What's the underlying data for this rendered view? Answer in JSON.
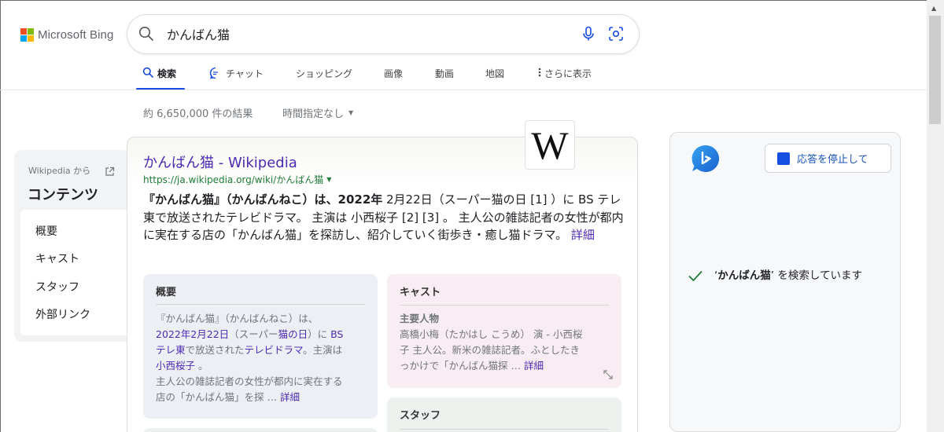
{
  "brand": {
    "logo_text": "Microsoft Bing",
    "logo_colors": [
      "#f25022",
      "#7fba00",
      "#00a4ef",
      "#ffb900"
    ]
  },
  "search": {
    "query": "かんばん猫",
    "icons": [
      "search-icon",
      "microphone-icon",
      "visual-search-icon"
    ]
  },
  "tabs": [
    {
      "label": "検索",
      "icon": "search-icon",
      "active": true
    },
    {
      "label": "チャット",
      "icon": "chat-icon"
    },
    {
      "label": "ショッピング"
    },
    {
      "label": "画像"
    },
    {
      "label": "動画"
    },
    {
      "label": "地図"
    },
    {
      "label": "さらに表示",
      "icon": "more-vertical-icon"
    }
  ],
  "results_meta": {
    "count": "約 6,650,000 件の結果",
    "time_filter": "時間指定なし"
  },
  "contents_panel": {
    "source": "Wikipedia から",
    "title": "コンテンツ",
    "items": [
      "概要",
      "キャスト",
      "スタッフ",
      "外部リンク"
    ]
  },
  "result": {
    "title": "かんばん猫 - Wikipedia",
    "url": "https://ja.wikipedia.org/wiki/かんばん猫",
    "logo_letter": "W",
    "snippet": {
      "bold": "『かんばん猫』（かんばんねこ）は、2022年",
      "text": " 2月22日（スーパー猫の日 [1] ）に BS テレ東で放送されたテレビドラマ。 主演は 小西桜子 [2] [3] 。 主人公の雑誌記者の女性が都内に実在する店の「かんばん猫」を探訪し、紹介していく街歩き・癒し猫ドラマ。 ",
      "more": "詳細"
    }
  },
  "subcards": {
    "overview": {
      "title": "概要",
      "lines": [
        {
          "text": "『かんばん猫』（かんばんねこ）は、"
        },
        {
          "link1": "2022年2月22日",
          "text1": "（スーパー",
          "link2": "猫の日",
          "text2": "）に ",
          "link3": "BS"
        },
        {
          "link1": "テレ東",
          "text1": "で放送された",
          "link2": "テレビドラマ",
          "text2": "。主演は"
        },
        {
          "link1": "小西桜子",
          "text1": " 。"
        },
        {
          "text": "主人公の雑誌記者の女性が都内に実在する"
        },
        {
          "text": "店の「かんばん猫」を探 … ",
          "link": "詳細"
        }
      ]
    },
    "cast": {
      "title": "キャスト",
      "subtitle": "主要人物",
      "lines": [
        "高橋小梅（たかはし こうめ） 演 - 小西桜",
        "子 主人公。新米の雑誌記者。ふとしたき",
        "っかけで「かんばん猫探 … "
      ],
      "more": "詳細"
    },
    "staff": {
      "title": "スタッフ"
    },
    "colors": {
      "overview_bg": "#eceff4",
      "cast_bg": "#f7edf3",
      "staff_bg": "#eef2ef"
    }
  },
  "copilot": {
    "stop_label": "応答を停止して",
    "status_pre": "‘",
    "status_bold": "かんばん猫",
    "status_post": "’ を検索しています"
  },
  "colors": {
    "accent": "#174ae4",
    "link": "#4d2ab3",
    "url": "#1e7b35",
    "check": "#1e7b35"
  }
}
